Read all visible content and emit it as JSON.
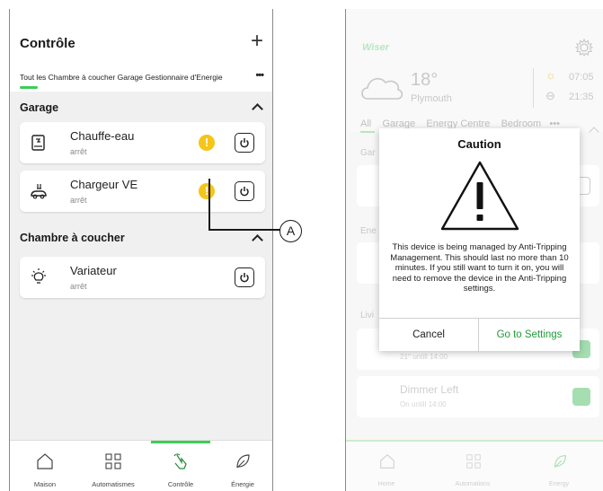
{
  "left": {
    "title": "Contrôle",
    "add_symbol": "+",
    "tabs_text": "Tout les Chambre à coucher Garage Gestionnaire d'Energie",
    "more_symbol": "•••",
    "sections": [
      {
        "title": "Garage",
        "devices": [
          {
            "name": "Chauffe-eau",
            "status": "arrêt",
            "warning": "!"
          },
          {
            "name": "Chargeur VE",
            "status": "arrêt",
            "warning": "!"
          }
        ]
      },
      {
        "title": "Chambre à coucher",
        "devices": [
          {
            "name": "Variateur",
            "status": "arrêt"
          }
        ]
      }
    ],
    "callout_label": "A",
    "nav": [
      {
        "label": "Maison",
        "icon": "home-icon"
      },
      {
        "label": "Automatismes",
        "icon": "grid-icon"
      },
      {
        "label": "Contrôle",
        "icon": "hand-tap-icon",
        "active": true
      },
      {
        "label": "Énergie",
        "icon": "leaf-icon"
      }
    ]
  },
  "right": {
    "logo": "Wiser",
    "weather": {
      "temp": "18°",
      "city": "Plymouth",
      "sunrise": "07:05",
      "sunset": "21:35"
    },
    "tabs": [
      "All",
      "Garage",
      "Energy Centre",
      "Bedroom",
      "•••"
    ],
    "sections": [
      "Gar",
      "Ene",
      "Livi"
    ],
    "devices": [
      {
        "name": "",
        "status": "21° untill 14:00"
      },
      {
        "name": "Dimmer Left",
        "status": "On untill 14:00"
      }
    ],
    "nav": [
      "Home",
      "Automations",
      "Energy"
    ]
  },
  "dialog": {
    "title": "Caution",
    "message": "This device is being managed by Anti-Tripping Management. This should last no more than 10 minutes. If you still want to turn it on, you will need to remove the device in the Anti-Tripping settings.",
    "cancel_label": "Cancel",
    "settings_label": "Go to Settings"
  },
  "colors": {
    "accent": "#3dcd58",
    "warning": "#f5c518",
    "link": "#1f9b3a"
  }
}
